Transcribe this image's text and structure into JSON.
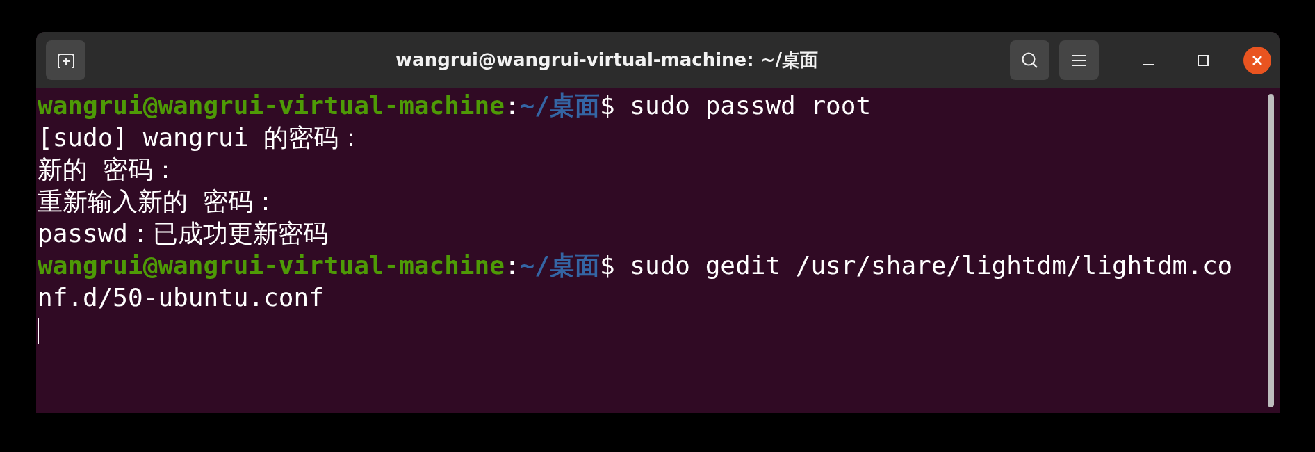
{
  "window": {
    "title": "wangrui@wangrui-virtual-machine: ~/桌面"
  },
  "lines": [
    {
      "kind": "prompt",
      "user_host": "wangrui@wangrui-virtual-machine",
      "separator": ":",
      "path": "~/桌面",
      "symbol": "$",
      "command": "sudo passwd root"
    },
    {
      "kind": "output",
      "text": "[sudo] wangrui 的密码："
    },
    {
      "kind": "output",
      "text": "新的 密码："
    },
    {
      "kind": "output",
      "text": "重新输入新的 密码："
    },
    {
      "kind": "output",
      "text": "passwd：已成功更新密码"
    },
    {
      "kind": "prompt",
      "user_host": "wangrui@wangrui-virtual-machine",
      "separator": ":",
      "path": "~/桌面",
      "symbol": "$",
      "command": "sudo gedit /usr/share/lightdm/lightdm.co"
    },
    {
      "kind": "output",
      "text": "nf.d/50-ubuntu.conf"
    },
    {
      "kind": "cursor"
    }
  ]
}
